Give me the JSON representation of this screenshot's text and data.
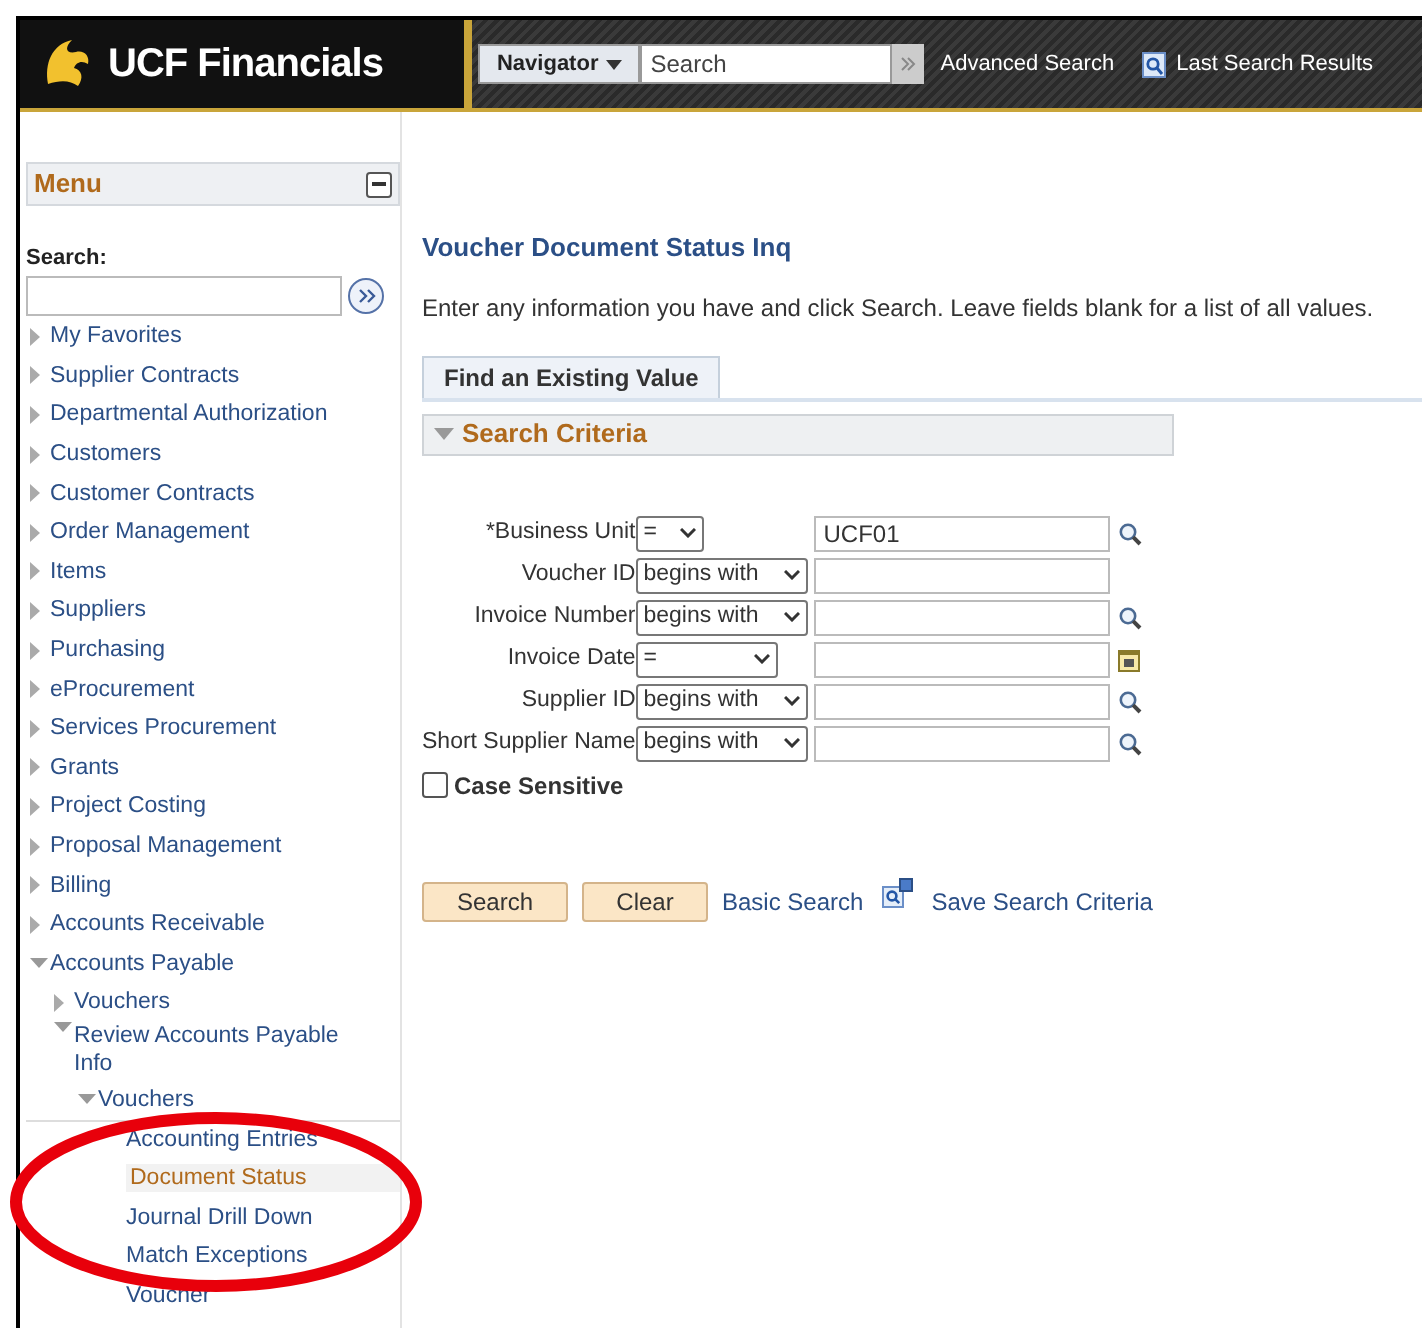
{
  "header": {
    "brand": "UCF Financials",
    "navigator": "Navigator",
    "search": {
      "placeholder": "Search"
    },
    "links": [
      "Advanced Search",
      "Last Search Results"
    ]
  },
  "menu": {
    "title": "Menu",
    "search_label": "Search:",
    "items": [
      {
        "label": "My Favorites",
        "expanded": false
      },
      {
        "label": "Supplier Contracts",
        "expanded": false
      },
      {
        "label": "Departmental Authorization",
        "expanded": false
      },
      {
        "label": "Customers",
        "expanded": false
      },
      {
        "label": "Customer Contracts",
        "expanded": false
      },
      {
        "label": "Order Management",
        "expanded": false
      },
      {
        "label": "Items",
        "expanded": false
      },
      {
        "label": "Suppliers",
        "expanded": false
      },
      {
        "label": "Purchasing",
        "expanded": false
      },
      {
        "label": "eProcurement",
        "expanded": false
      },
      {
        "label": "Services Procurement",
        "expanded": false
      },
      {
        "label": "Grants",
        "expanded": false
      },
      {
        "label": "Project Costing",
        "expanded": false
      },
      {
        "label": "Proposal Management",
        "expanded": false
      },
      {
        "label": "Billing",
        "expanded": false
      },
      {
        "label": "Accounts Receivable",
        "expanded": false
      },
      {
        "label": "Accounts Payable",
        "expanded": true,
        "children": [
          {
            "label": "Vouchers",
            "expanded": false
          },
          {
            "label": "Review Accounts Payable Info",
            "expanded": true,
            "children": [
              {
                "label": "Vouchers",
                "expanded": true,
                "children": [
                  {
                    "label": "Accounting Entries",
                    "selected": false
                  },
                  {
                    "label": "Document Status",
                    "selected": true
                  },
                  {
                    "label": "Journal Drill Down",
                    "selected": false
                  },
                  {
                    "label": "Match Exceptions",
                    "selected": false
                  },
                  {
                    "label": "Voucher",
                    "selected": false
                  }
                ]
              }
            ]
          }
        ]
      }
    ]
  },
  "page": {
    "title": "Voucher Document Status Inq",
    "instructions": "Enter any information you have and click Search. Leave fields blank for a list of all values.",
    "tabs": [
      {
        "label": "Find an Existing Value",
        "selected": true
      }
    ],
    "section": {
      "title": "Search Criteria",
      "expanded": true
    },
    "fields": [
      {
        "label": "*Business Unit",
        "kind": "key",
        "operator": "=",
        "value": "UCF01",
        "lookup": true
      },
      {
        "label": "Voucher ID",
        "kind": "text",
        "operator": "begins with",
        "lookup": false
      },
      {
        "label": "Invoice Number",
        "kind": "text",
        "operator": "begins with",
        "lookup": true
      },
      {
        "label": "Invoice Date",
        "kind": "date",
        "operator": "="
      },
      {
        "label": "Supplier ID",
        "kind": "text",
        "operator": "begins with",
        "lookup": true
      },
      {
        "label": "Short Supplier Name",
        "kind": "text",
        "operator": "begins with",
        "lookup": true
      }
    ],
    "case_sensitive": {
      "label": "Case Sensitive",
      "checked": false
    },
    "buttons": [
      "Search",
      "Clear"
    ],
    "links": [
      "Basic Search",
      "Save Search Criteria"
    ]
  }
}
